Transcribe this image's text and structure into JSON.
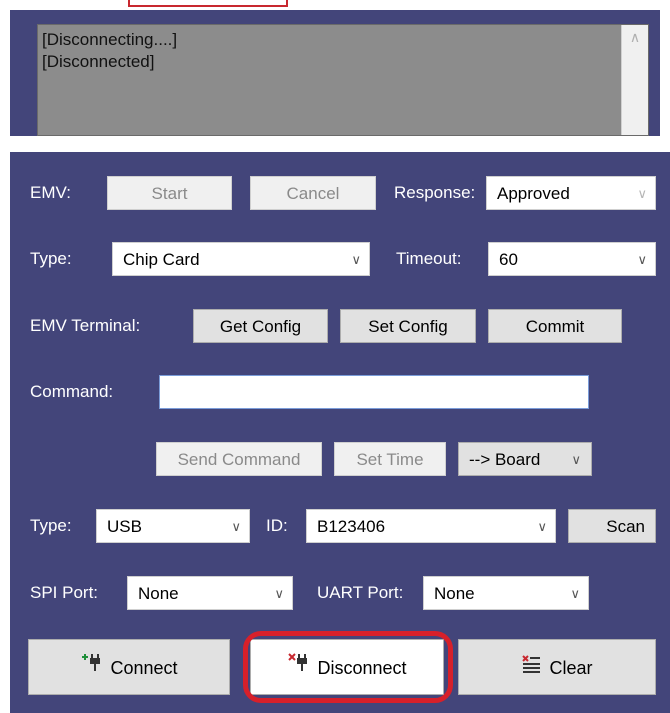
{
  "log": {
    "lines": [
      "[Disconnecting....]",
      "[Disconnected]"
    ],
    "scroll_up_icon": "chevron-up-icon"
  },
  "emv": {
    "label": "EMV:",
    "start": "Start",
    "cancel": "Cancel",
    "response_label": "Response:",
    "response_value": "Approved"
  },
  "type_row": {
    "label": "Type:",
    "value": "Chip Card",
    "timeout_label": "Timeout:",
    "timeout_value": "60"
  },
  "terminal": {
    "label": "EMV Terminal:",
    "get_config": "Get Config",
    "set_config": "Set Config",
    "commit": "Commit"
  },
  "command": {
    "label": "Command:",
    "value": ""
  },
  "actions": {
    "send_command": "Send Command",
    "set_time": "Set Time",
    "target": "--> Board"
  },
  "connection": {
    "type_label": "Type:",
    "type_value": "USB",
    "id_label": "ID:",
    "id_value": "B123406",
    "scan": "Scan"
  },
  "ports": {
    "spi_label": "SPI Port:",
    "spi_value": "None",
    "uart_label": "UART Port:",
    "uart_value": "None"
  },
  "bottom": {
    "connect": "Connect",
    "disconnect": "Disconnect",
    "clear": "Clear"
  },
  "colors": {
    "panel": "#43457a",
    "log_bg": "#8c8c8c",
    "highlight": "#d7202a"
  }
}
